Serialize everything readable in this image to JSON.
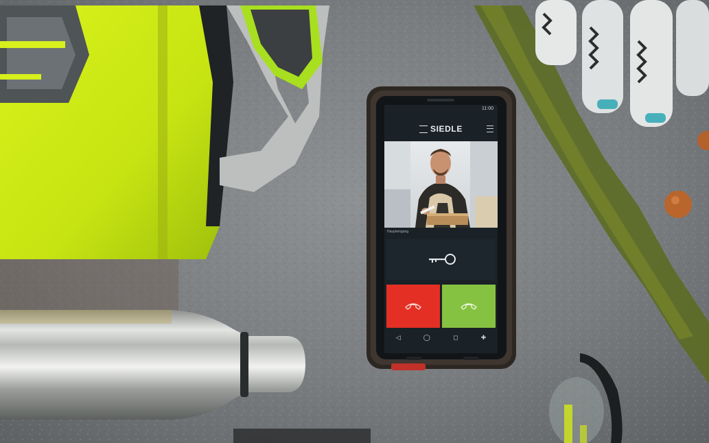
{
  "scene": {
    "description_items": [
      "backpack-icon",
      "glove-icon",
      "water-bottle-icon",
      "sunglasses-icon",
      "rock-surface"
    ]
  },
  "phone": {
    "status_time": "11:00",
    "app_name": "SIEDLE",
    "door_label": "Haupteingang",
    "nav_icons": [
      "back-icon",
      "home-icon",
      "recent-apps-icon",
      "add-icon"
    ],
    "colors": {
      "reject": "#e43024",
      "accept": "#86c241",
      "screen_bg": "#1a2127"
    }
  }
}
